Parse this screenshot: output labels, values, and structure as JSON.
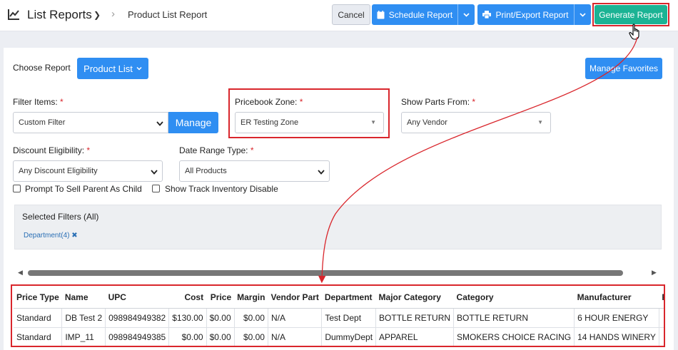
{
  "header": {
    "title": "List Reports",
    "breadcrumb_current": "Product List Report",
    "cancel_label": "Cancel",
    "schedule_label": "Schedule Report",
    "print_label": "Print/Export Report",
    "generate_label": "Generate Report"
  },
  "report": {
    "choose_label": "Choose Report",
    "product_button": "Product List",
    "favorites_button": "Manage Favorites"
  },
  "form": {
    "filter_items_label": "Filter Items:",
    "filter_items_value": "Custom Filter",
    "manage_button": "Manage",
    "pricebook_zone_label": "Pricebook Zone:",
    "pricebook_zone_value": "ER Testing Zone",
    "show_parts_label": "Show Parts From:",
    "show_parts_value": "Any Vendor",
    "discount_label": "Discount Eligibility:",
    "discount_value": "Any Discount Eligibility",
    "date_range_label": "Date Range Type:",
    "date_range_value": "All Products",
    "required_marker": "*",
    "prompt_sell_label": "Prompt To Sell Parent As Child",
    "track_inventory_label": "Show Track Inventory Disable"
  },
  "filters": {
    "title": "Selected Filters (All)",
    "tag": "Department(4)",
    "tag_close": "✖"
  },
  "table": {
    "columns": [
      "Price Type",
      "Name",
      "UPC",
      "Cost",
      "Price",
      "Margin",
      "Vendor Part",
      "Department",
      "Major Category",
      "Category",
      "Manufacturer",
      "POS"
    ],
    "rows": [
      [
        "Standard",
        "DB Test 2",
        "098984949382",
        "$130.00",
        "$0.00",
        "$0.00",
        "N/A",
        "Test Dept",
        "BOTTLE RETURN",
        "BOTTLE RETURN",
        "6 HOUR ENERGY",
        ""
      ],
      [
        "Standard",
        "IMP_11",
        "098984949385",
        "$0.00",
        "$0.00",
        "$0.00",
        "N/A",
        "DummyDept",
        "APPAREL",
        "SMOKERS CHOICE RACING",
        "14 HANDS WINERY",
        ""
      ]
    ]
  },
  "colors": {
    "primary_blue": "#2f8ef2",
    "generate_green": "#1bb394",
    "highlight_red": "#d9262c"
  }
}
